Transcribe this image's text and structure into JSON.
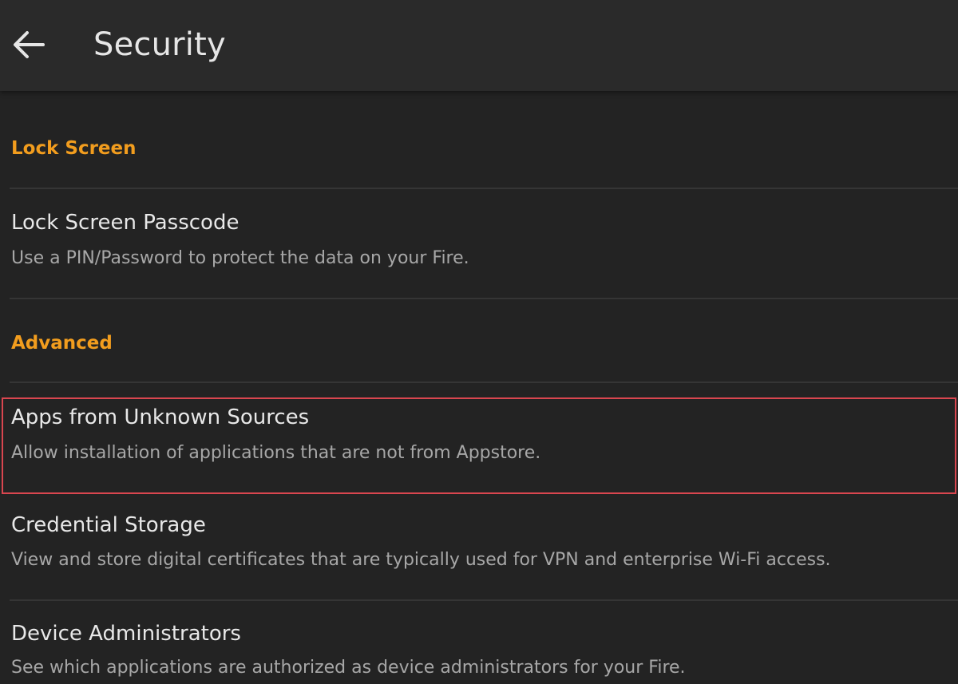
{
  "header": {
    "title": "Security",
    "back_icon": "arrow-left-icon"
  },
  "colors": {
    "background": "#232323",
    "header_background": "#2a2a2a",
    "section_header": "#f29d1e",
    "title_text": "#e8e8e8",
    "subtitle_text": "#a7a7a7",
    "highlight_border": "#d9464f"
  },
  "sections": [
    {
      "header": "Lock Screen",
      "items": [
        {
          "title": "Lock Screen Passcode",
          "subtitle": "Use a PIN/Password to protect the data on your Fire."
        }
      ]
    },
    {
      "header": "Advanced",
      "items": [
        {
          "title": "Apps from Unknown Sources",
          "subtitle": "Allow installation of applications that are not from Appstore.",
          "highlighted": true
        },
        {
          "title": "Credential Storage",
          "subtitle": "View and store digital certificates that are typically used for VPN and enterprise Wi-Fi access."
        },
        {
          "title": "Device Administrators",
          "subtitle": "See which applications are authorized as device administrators for your Fire."
        }
      ]
    }
  ]
}
